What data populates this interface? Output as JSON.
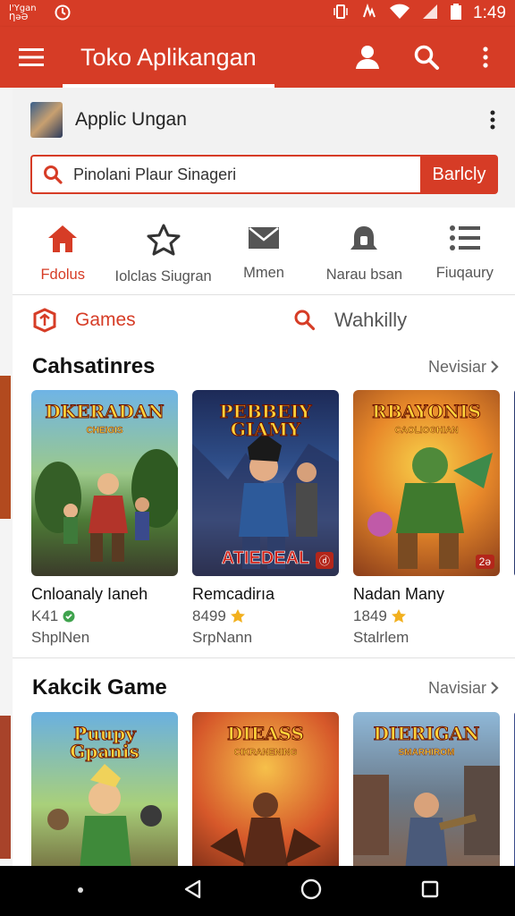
{
  "status_bar": {
    "carrier": "I'Ygan ȠəƏ",
    "time": "1:49",
    "icons": [
      "sync-icon",
      "vibrate-icon",
      "signal-icon",
      "wifi-icon",
      "cell-signal-icon",
      "battery-icon"
    ]
  },
  "toolbar": {
    "title": "Toko  Aplikangan",
    "icons": [
      "menu-icon",
      "account-icon",
      "search-icon",
      "more-vert-icon"
    ],
    "color": "#d63c26"
  },
  "account": {
    "name": "Applic Ungan"
  },
  "search": {
    "query": "Pinolani Plaur Sinageri",
    "button_label": "Barlcly"
  },
  "nav_tabs": [
    {
      "label": "Fdolus",
      "icon": "home-icon",
      "active": true
    },
    {
      "label": "Iolclas Siugran",
      "icon": "star-icon",
      "active": false
    },
    {
      "label": "Mmen",
      "icon": "mail-icon",
      "active": false
    },
    {
      "label": "Narau bsan",
      "icon": "bell-icon",
      "active": false
    },
    {
      "label": "Fiuqaury",
      "icon": "list-icon",
      "active": false
    }
  ],
  "filter": {
    "category_label": "Games",
    "search_label": "Wahkilly"
  },
  "sections": [
    {
      "title": "Cahsatinres",
      "more_label": "Nevisiar",
      "apps": [
        {
          "thumb_title": "DKERADAN",
          "thumb_sub": "CHEIGIS",
          "name": "Cnloanaly Ianeh",
          "rating": "K41",
          "dev": "ShplNen",
          "badge": ""
        },
        {
          "thumb_title": "PEBBEIY GIAMY",
          "thumb_sub": "",
          "banner": "ATIEDEAL",
          "badge": "ⓓ",
          "name": "Remcadirıa",
          "rating": "8499",
          "dev": "SrpNann"
        },
        {
          "thumb_title": "RBAYONIS",
          "thumb_sub": "CAOLIOGHIAN",
          "badge": "2ə",
          "name": "Nadan Many",
          "rating": "1849",
          "dev": "Stalrlem"
        }
      ]
    },
    {
      "title": "Kakcik Game",
      "more_label": "Navisiar",
      "apps": [
        {
          "thumb_title": "Puupy Gpanis",
          "thumb_sub": ""
        },
        {
          "thumb_title": "DIEASS",
          "thumb_sub": "CIKRANENING"
        },
        {
          "thumb_title": "DIERIGAN",
          "thumb_sub": "SMARHIROM"
        }
      ]
    }
  ]
}
